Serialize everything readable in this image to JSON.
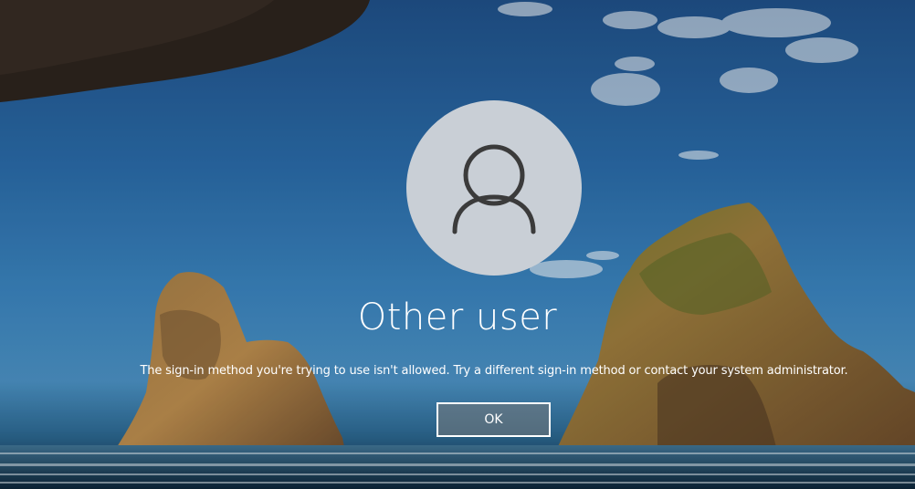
{
  "login": {
    "avatar_icon": "user-icon",
    "username": "Other user",
    "message": "The sign-in method you're trying to use isn't allowed. Try a different sign-in method or contact your system administrator.",
    "ok_label": "OK"
  },
  "colors": {
    "text": "#ffffff",
    "avatar_bg": "#c9cfd6",
    "icon_stroke": "#3b3b3b"
  }
}
